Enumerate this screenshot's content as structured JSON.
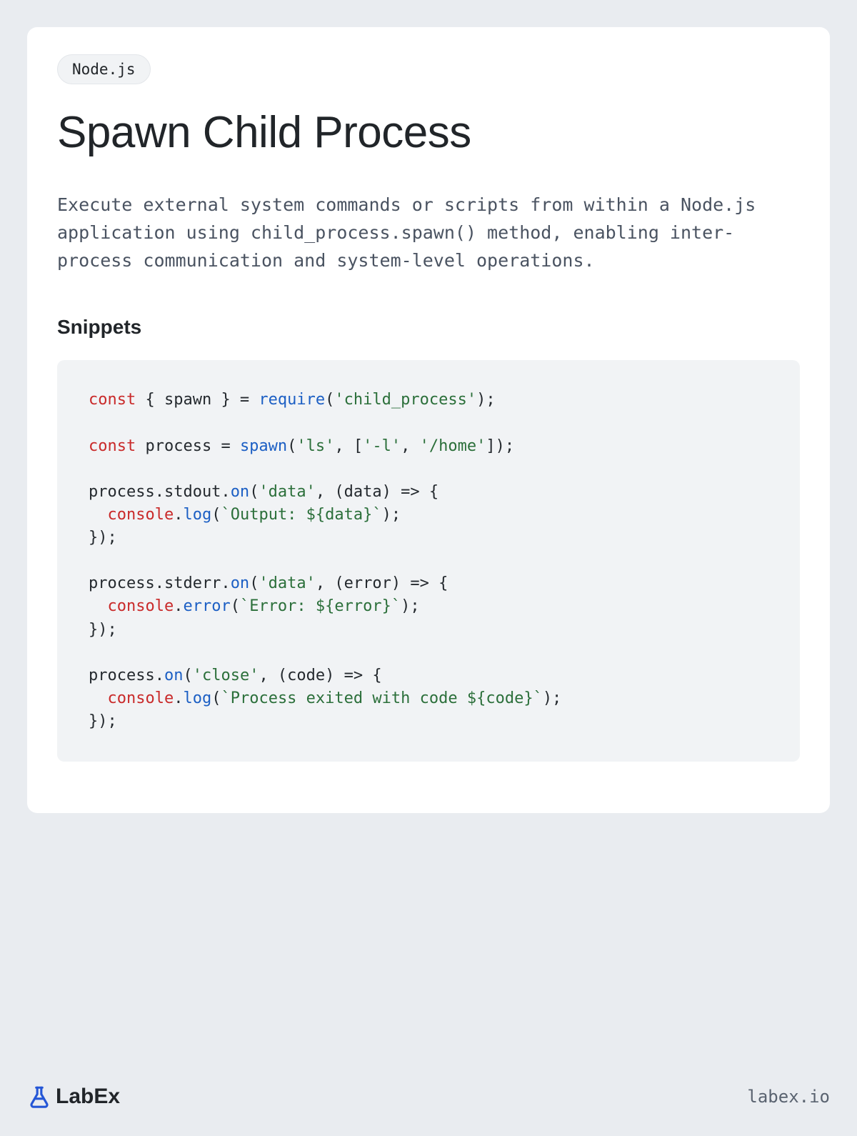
{
  "tag": "Node.js",
  "title": "Spawn Child Process",
  "description": "Execute external system commands or scripts from within a Node.js application using child_process.spawn() method, enabling inter-process communication and system-level operations.",
  "section_heading": "Snippets",
  "code": {
    "tokens": [
      {
        "t": "const",
        "c": "kw"
      },
      {
        "t": " { spawn } = ",
        "c": "default"
      },
      {
        "t": "require",
        "c": "fn"
      },
      {
        "t": "(",
        "c": "default"
      },
      {
        "t": "'child_process'",
        "c": "str"
      },
      {
        "t": ");\n\n",
        "c": "default"
      },
      {
        "t": "const",
        "c": "kw"
      },
      {
        "t": " process = ",
        "c": "default"
      },
      {
        "t": "spawn",
        "c": "fn"
      },
      {
        "t": "(",
        "c": "default"
      },
      {
        "t": "'ls'",
        "c": "str"
      },
      {
        "t": ", [",
        "c": "default"
      },
      {
        "t": "'-l'",
        "c": "str"
      },
      {
        "t": ", ",
        "c": "default"
      },
      {
        "t": "'/home'",
        "c": "str"
      },
      {
        "t": "]);\n\n",
        "c": "default"
      },
      {
        "t": "process.stdout.",
        "c": "default"
      },
      {
        "t": "on",
        "c": "prop"
      },
      {
        "t": "(",
        "c": "default"
      },
      {
        "t": "'data'",
        "c": "str"
      },
      {
        "t": ", (data) => {\n  ",
        "c": "default"
      },
      {
        "t": "console",
        "c": "kw"
      },
      {
        "t": ".",
        "c": "default"
      },
      {
        "t": "log",
        "c": "fn"
      },
      {
        "t": "(",
        "c": "default"
      },
      {
        "t": "`Output: ${data}`",
        "c": "tmpl"
      },
      {
        "t": ");\n});\n\n",
        "c": "default"
      },
      {
        "t": "process.stderr.",
        "c": "default"
      },
      {
        "t": "on",
        "c": "prop"
      },
      {
        "t": "(",
        "c": "default"
      },
      {
        "t": "'data'",
        "c": "str"
      },
      {
        "t": ", (error) => {\n  ",
        "c": "default"
      },
      {
        "t": "console",
        "c": "kw"
      },
      {
        "t": ".",
        "c": "default"
      },
      {
        "t": "error",
        "c": "fn"
      },
      {
        "t": "(",
        "c": "default"
      },
      {
        "t": "`Error: ${error}`",
        "c": "tmpl"
      },
      {
        "t": ");\n});\n\n",
        "c": "default"
      },
      {
        "t": "process.",
        "c": "default"
      },
      {
        "t": "on",
        "c": "prop"
      },
      {
        "t": "(",
        "c": "default"
      },
      {
        "t": "'close'",
        "c": "str"
      },
      {
        "t": ", (code) => {\n  ",
        "c": "default"
      },
      {
        "t": "console",
        "c": "kw"
      },
      {
        "t": ".",
        "c": "default"
      },
      {
        "t": "log",
        "c": "fn"
      },
      {
        "t": "(",
        "c": "default"
      },
      {
        "t": "`Process exited with code ${code}`",
        "c": "tmpl"
      },
      {
        "t": ");\n});",
        "c": "default"
      }
    ]
  },
  "brand": {
    "name": "LabEx",
    "url": "labex.io"
  }
}
